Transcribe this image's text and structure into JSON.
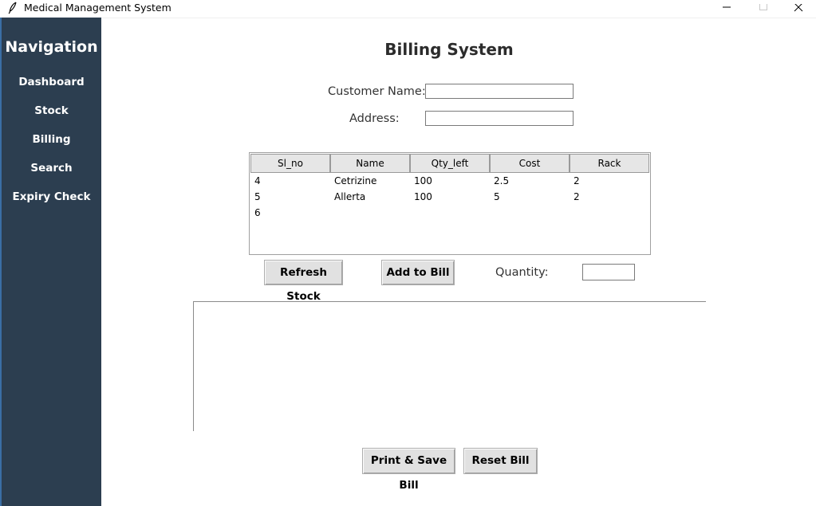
{
  "window": {
    "title": "Medical Management System",
    "icon": "feather-icon",
    "controls": [
      "minimize-icon",
      "maximize-icon",
      "close-icon"
    ]
  },
  "sidebar": {
    "heading": "Navigation",
    "background": "#2c3e50",
    "items": [
      {
        "label": "Dashboard"
      },
      {
        "label": "Stock"
      },
      {
        "label": "Billing"
      },
      {
        "label": "Search"
      },
      {
        "label": "Expiry Check"
      }
    ]
  },
  "main": {
    "title": "Billing System",
    "customer_name_label": "Customer Name:",
    "customer_name_value": "",
    "address_label": "Address:",
    "address_value": "",
    "stock_table": {
      "columns": [
        "Sl_no",
        "Name",
        "Qty_left",
        "Cost",
        "Rack"
      ],
      "rows": [
        [
          "4",
          "Cetrizine",
          "100",
          "2.5",
          "2"
        ],
        [
          "5",
          "Allerta",
          "100",
          "5",
          "2"
        ],
        [
          "6",
          "",
          "",
          "",
          ""
        ]
      ]
    },
    "refresh_button": "Refresh Stock",
    "add_button": "Add to Bill",
    "quantity_label": "Quantity:",
    "quantity_value": "",
    "bill_text": "",
    "print_button": "Print & Save Bill",
    "reset_button": "Reset Bill"
  }
}
